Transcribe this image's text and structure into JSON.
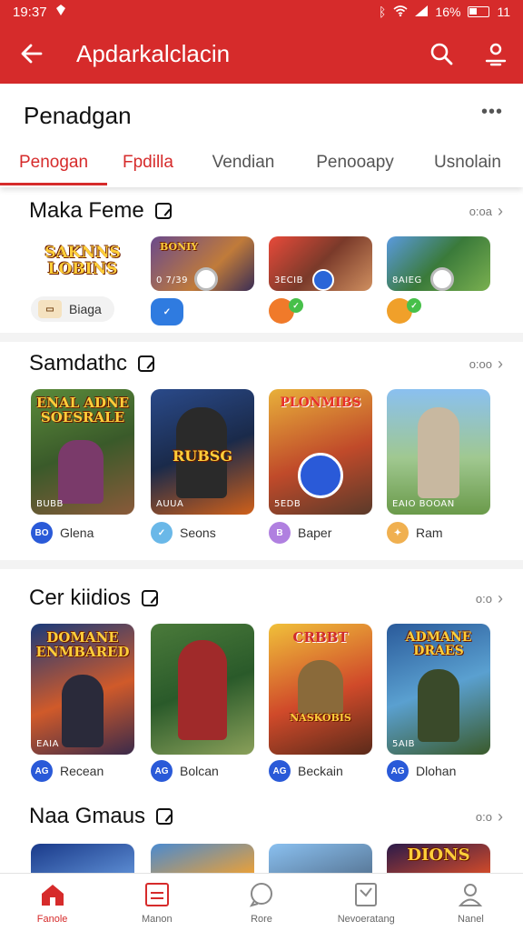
{
  "status_bar": {
    "time": "19:37",
    "battery": "16%",
    "extra": "11"
  },
  "app_bar": {
    "title": "Apdarkalclacin"
  },
  "header": {
    "title": "Penadgan",
    "tabs": [
      "Penogan",
      "Fpdilla",
      "Vendian",
      "Penooapy",
      "Usnolain"
    ]
  },
  "sections": [
    {
      "title": "Maka Feme",
      "more": "o:oa",
      "cards": [
        {
          "art": "SAKNNS LOBINS",
          "meta": "Biaga",
          "badge": ""
        },
        {
          "art": "BONIY",
          "meta": "",
          "badge": "0 7/39"
        },
        {
          "art": "",
          "meta": "",
          "badge": "3ECIB"
        },
        {
          "art": "",
          "meta": "",
          "badge": "8AIEG"
        }
      ]
    },
    {
      "title": "Samdathc",
      "more": "o:oo",
      "cards": [
        {
          "art": "ENAL ADNE SOESRALE",
          "meta": "Glena",
          "badge": "BUBB"
        },
        {
          "art": "RUBSG",
          "meta": "Seons",
          "badge": "AUUA"
        },
        {
          "art": "PLONMIBS",
          "meta": "Baper",
          "badge": "5EDB"
        },
        {
          "art": "",
          "meta": "Ram",
          "badge": "EAIO BOOAN"
        }
      ]
    },
    {
      "title": "Cer kiidios",
      "more": "o:o",
      "cards": [
        {
          "art": "DOMANE ENMBARED",
          "meta": "Recean",
          "badge": "EAIA",
          "ico": "AG"
        },
        {
          "art": "",
          "meta": "Bolcan",
          "badge": "",
          "ico": "AG"
        },
        {
          "art": "CRBBT NASKOBIS",
          "meta": "Beckain",
          "badge": "",
          "ico": "AG"
        },
        {
          "art": "ADMANE DRAES",
          "meta": "Dlohan",
          "badge": "5AIB",
          "ico": "AG"
        }
      ]
    },
    {
      "title": "Naa Gmaus",
      "more": "o:o",
      "cards": [
        {
          "art": ""
        },
        {
          "art": ""
        },
        {
          "art": ""
        },
        {
          "art": "DIONS"
        }
      ]
    }
  ],
  "bottom_nav": [
    "Fanole",
    "Manon",
    "Rore",
    "Nevoeratang",
    "Nanel"
  ],
  "colors": {
    "accent": "#d62b2b"
  }
}
